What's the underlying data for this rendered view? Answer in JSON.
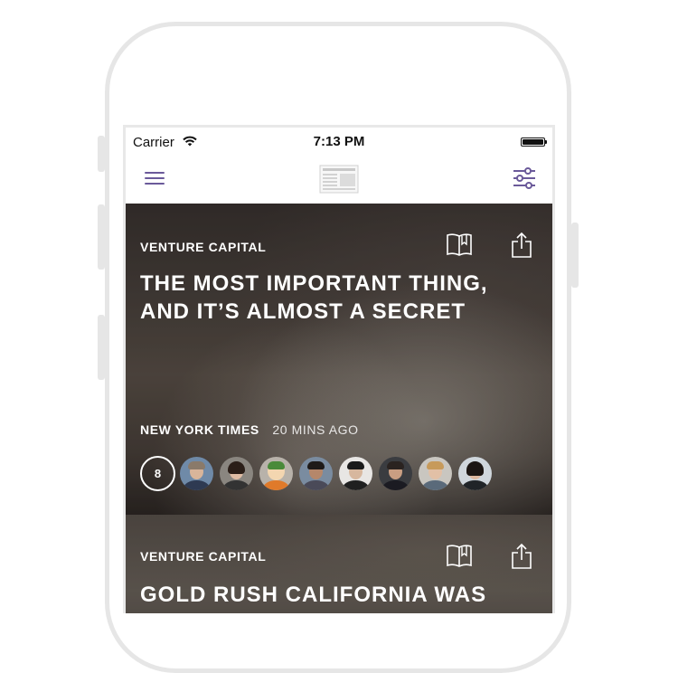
{
  "status_bar": {
    "carrier": "Carrier",
    "time": "7:13 PM"
  },
  "icons": {
    "menu": "hamburger-menu-icon",
    "logo": "newspaper-logo-icon",
    "filter": "sliders-filter-icon",
    "bookmark": "open-book-bookmark-icon",
    "share": "share-upload-icon"
  },
  "colors": {
    "accent": "#6b5a9a",
    "text_on_image": "#ffffff"
  },
  "articles": [
    {
      "category": "VENTURE CAPITAL",
      "headline_line1": "THE MOST IMPORTANT THING,",
      "headline_line2": "AND IT’S ALMOST A SECRET",
      "source": "NEW YORK TIMES",
      "time_ago": "20 MINS AGO",
      "share_count": "8"
    },
    {
      "category": "VENTURE CAPITAL",
      "headline_line1": "GOLD RUSH CALIFORNIA WAS"
    }
  ]
}
